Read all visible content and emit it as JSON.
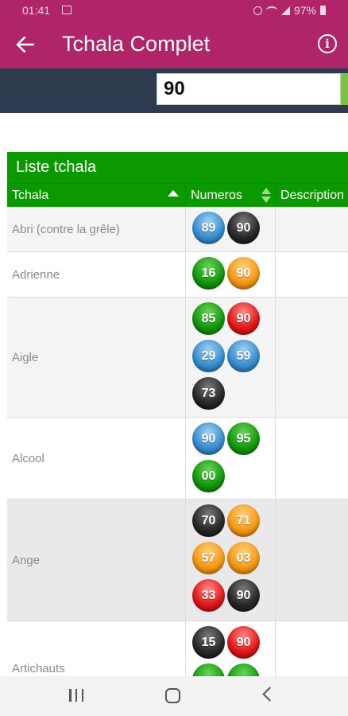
{
  "status_bar": {
    "time": "01:41",
    "battery_text": "97%"
  },
  "app_bar": {
    "title": "Tchala Complet",
    "back_icon": "arrow-left-icon",
    "info_icon": "info-icon"
  },
  "search": {
    "value": "90"
  },
  "table": {
    "caption": "Liste tchala",
    "headers": {
      "tchala": "Tchala",
      "numeros": "Numeros",
      "description": "Description"
    },
    "rows": [
      {
        "name": "Abri (contre la grêle)",
        "numbers": [
          {
            "n": "89",
            "color": "blue"
          },
          {
            "n": "90",
            "color": "black"
          }
        ]
      },
      {
        "name": "Adrienne",
        "numbers": [
          {
            "n": "16",
            "color": "green"
          },
          {
            "n": "90",
            "color": "orange"
          }
        ]
      },
      {
        "name": "Aigle",
        "numbers": [
          {
            "n": "85",
            "color": "green"
          },
          {
            "n": "90",
            "color": "red"
          },
          {
            "n": "29",
            "color": "blue"
          },
          {
            "n": "59",
            "color": "blue"
          },
          {
            "n": "73",
            "color": "black"
          }
        ]
      },
      {
        "name": "Alcool",
        "numbers": [
          {
            "n": "90",
            "color": "blue"
          },
          {
            "n": "95",
            "color": "green"
          },
          {
            "n": "00",
            "color": "green"
          }
        ]
      },
      {
        "name": "Ange",
        "numbers": [
          {
            "n": "70",
            "color": "black"
          },
          {
            "n": "71",
            "color": "orange"
          },
          {
            "n": "57",
            "color": "orange"
          },
          {
            "n": "03",
            "color": "orange"
          },
          {
            "n": "33",
            "color": "red"
          },
          {
            "n": "90",
            "color": "black"
          }
        ]
      },
      {
        "name": "Artichauts",
        "numbers": [
          {
            "n": "15",
            "color": "black"
          },
          {
            "n": "90",
            "color": "red"
          },
          {
            "n": "",
            "color": "green"
          },
          {
            "n": "",
            "color": "green"
          }
        ]
      }
    ]
  },
  "colors": {
    "app_bar": "#b0246a",
    "search_strip": "#2e3b4e",
    "table_header": "#0a9a00"
  }
}
